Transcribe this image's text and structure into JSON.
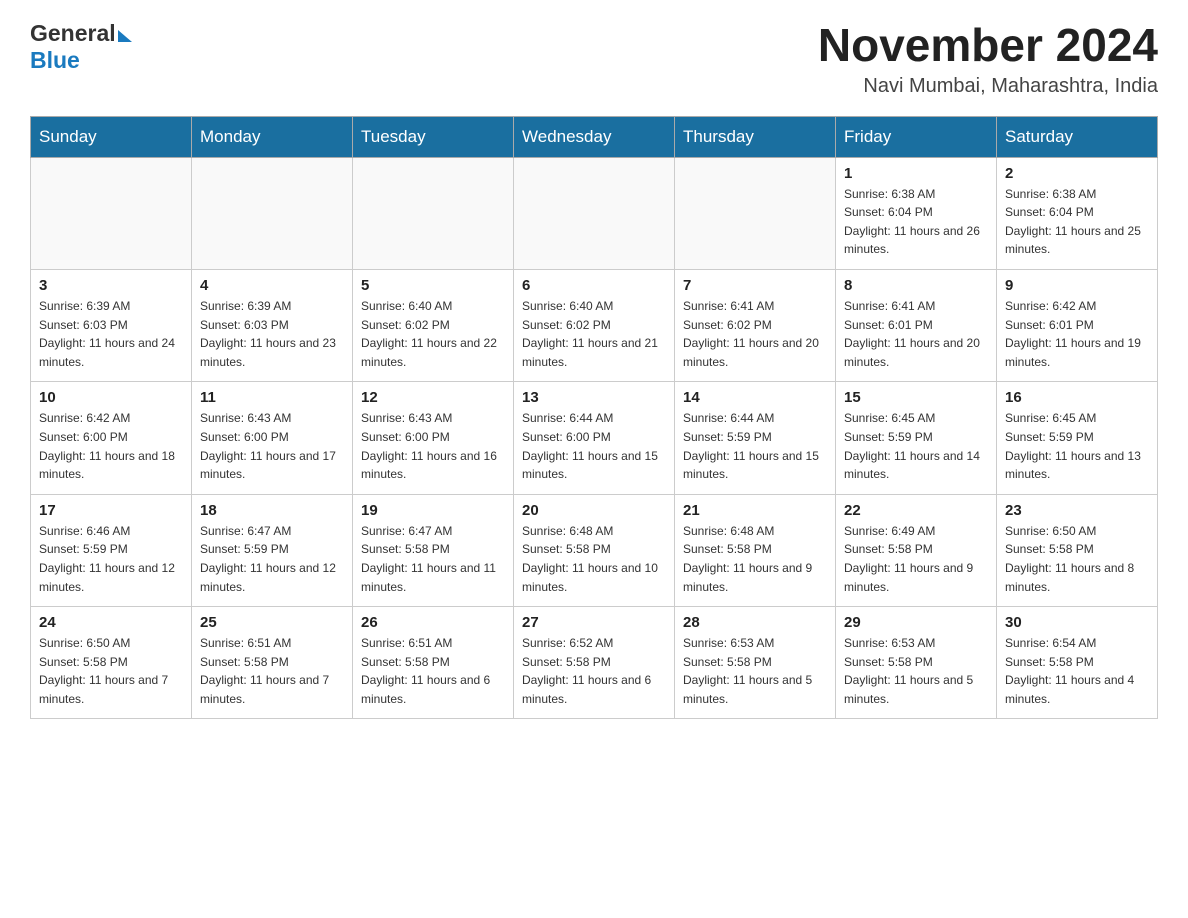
{
  "header": {
    "logo_general": "General",
    "logo_blue": "Blue",
    "month_title": "November 2024",
    "location": "Navi Mumbai, Maharashtra, India"
  },
  "days_of_week": [
    "Sunday",
    "Monday",
    "Tuesday",
    "Wednesday",
    "Thursday",
    "Friday",
    "Saturday"
  ],
  "weeks": [
    [
      {
        "day": "",
        "info": ""
      },
      {
        "day": "",
        "info": ""
      },
      {
        "day": "",
        "info": ""
      },
      {
        "day": "",
        "info": ""
      },
      {
        "day": "",
        "info": ""
      },
      {
        "day": "1",
        "info": "Sunrise: 6:38 AM\nSunset: 6:04 PM\nDaylight: 11 hours and 26 minutes."
      },
      {
        "day": "2",
        "info": "Sunrise: 6:38 AM\nSunset: 6:04 PM\nDaylight: 11 hours and 25 minutes."
      }
    ],
    [
      {
        "day": "3",
        "info": "Sunrise: 6:39 AM\nSunset: 6:03 PM\nDaylight: 11 hours and 24 minutes."
      },
      {
        "day": "4",
        "info": "Sunrise: 6:39 AM\nSunset: 6:03 PM\nDaylight: 11 hours and 23 minutes."
      },
      {
        "day": "5",
        "info": "Sunrise: 6:40 AM\nSunset: 6:02 PM\nDaylight: 11 hours and 22 minutes."
      },
      {
        "day": "6",
        "info": "Sunrise: 6:40 AM\nSunset: 6:02 PM\nDaylight: 11 hours and 21 minutes."
      },
      {
        "day": "7",
        "info": "Sunrise: 6:41 AM\nSunset: 6:02 PM\nDaylight: 11 hours and 20 minutes."
      },
      {
        "day": "8",
        "info": "Sunrise: 6:41 AM\nSunset: 6:01 PM\nDaylight: 11 hours and 20 minutes."
      },
      {
        "day": "9",
        "info": "Sunrise: 6:42 AM\nSunset: 6:01 PM\nDaylight: 11 hours and 19 minutes."
      }
    ],
    [
      {
        "day": "10",
        "info": "Sunrise: 6:42 AM\nSunset: 6:00 PM\nDaylight: 11 hours and 18 minutes."
      },
      {
        "day": "11",
        "info": "Sunrise: 6:43 AM\nSunset: 6:00 PM\nDaylight: 11 hours and 17 minutes."
      },
      {
        "day": "12",
        "info": "Sunrise: 6:43 AM\nSunset: 6:00 PM\nDaylight: 11 hours and 16 minutes."
      },
      {
        "day": "13",
        "info": "Sunrise: 6:44 AM\nSunset: 6:00 PM\nDaylight: 11 hours and 15 minutes."
      },
      {
        "day": "14",
        "info": "Sunrise: 6:44 AM\nSunset: 5:59 PM\nDaylight: 11 hours and 15 minutes."
      },
      {
        "day": "15",
        "info": "Sunrise: 6:45 AM\nSunset: 5:59 PM\nDaylight: 11 hours and 14 minutes."
      },
      {
        "day": "16",
        "info": "Sunrise: 6:45 AM\nSunset: 5:59 PM\nDaylight: 11 hours and 13 minutes."
      }
    ],
    [
      {
        "day": "17",
        "info": "Sunrise: 6:46 AM\nSunset: 5:59 PM\nDaylight: 11 hours and 12 minutes."
      },
      {
        "day": "18",
        "info": "Sunrise: 6:47 AM\nSunset: 5:59 PM\nDaylight: 11 hours and 12 minutes."
      },
      {
        "day": "19",
        "info": "Sunrise: 6:47 AM\nSunset: 5:58 PM\nDaylight: 11 hours and 11 minutes."
      },
      {
        "day": "20",
        "info": "Sunrise: 6:48 AM\nSunset: 5:58 PM\nDaylight: 11 hours and 10 minutes."
      },
      {
        "day": "21",
        "info": "Sunrise: 6:48 AM\nSunset: 5:58 PM\nDaylight: 11 hours and 9 minutes."
      },
      {
        "day": "22",
        "info": "Sunrise: 6:49 AM\nSunset: 5:58 PM\nDaylight: 11 hours and 9 minutes."
      },
      {
        "day": "23",
        "info": "Sunrise: 6:50 AM\nSunset: 5:58 PM\nDaylight: 11 hours and 8 minutes."
      }
    ],
    [
      {
        "day": "24",
        "info": "Sunrise: 6:50 AM\nSunset: 5:58 PM\nDaylight: 11 hours and 7 minutes."
      },
      {
        "day": "25",
        "info": "Sunrise: 6:51 AM\nSunset: 5:58 PM\nDaylight: 11 hours and 7 minutes."
      },
      {
        "day": "26",
        "info": "Sunrise: 6:51 AM\nSunset: 5:58 PM\nDaylight: 11 hours and 6 minutes."
      },
      {
        "day": "27",
        "info": "Sunrise: 6:52 AM\nSunset: 5:58 PM\nDaylight: 11 hours and 6 minutes."
      },
      {
        "day": "28",
        "info": "Sunrise: 6:53 AM\nSunset: 5:58 PM\nDaylight: 11 hours and 5 minutes."
      },
      {
        "day": "29",
        "info": "Sunrise: 6:53 AM\nSunset: 5:58 PM\nDaylight: 11 hours and 5 minutes."
      },
      {
        "day": "30",
        "info": "Sunrise: 6:54 AM\nSunset: 5:58 PM\nDaylight: 11 hours and 4 minutes."
      }
    ]
  ]
}
